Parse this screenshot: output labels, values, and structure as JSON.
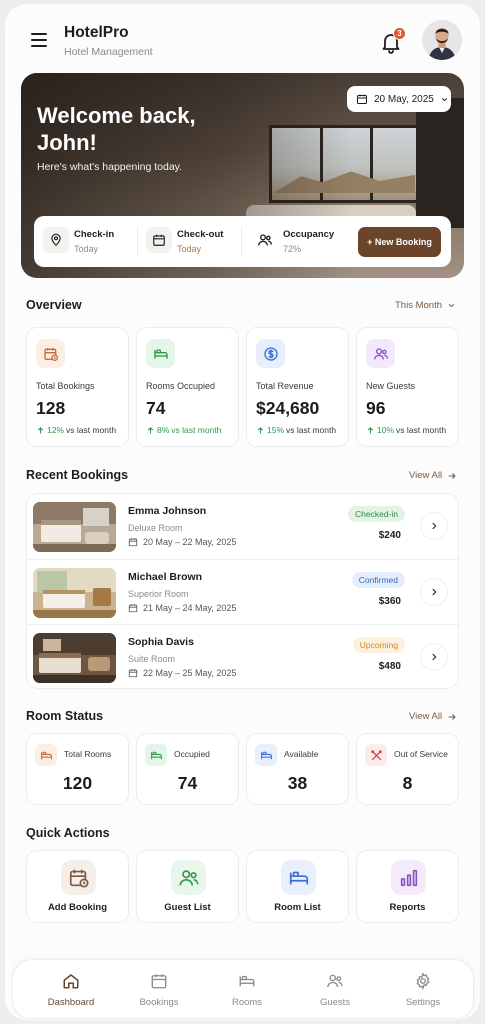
{
  "header": {
    "brand": "HotelPro",
    "subtitle": "Hotel Management",
    "notifications": "3",
    "icons": [
      "menu-icon",
      "bell-icon",
      "user-avatar"
    ]
  },
  "hero": {
    "title": "Welcome back, John!",
    "subtitle": "Here's what's happening today.",
    "date": "20 May, 2025",
    "stats": [
      {
        "label": "Check-in",
        "value": "Today",
        "icon": "location-pin-icon"
      },
      {
        "label": "Check-out",
        "value": "Today",
        "icon": "calendar-icon"
      },
      {
        "label": "Occupancy",
        "value": "72%",
        "icon": "users-icon"
      }
    ],
    "new_booking": "+ New Booking"
  },
  "overview": {
    "title": "Overview",
    "period": "This Month",
    "cards": [
      {
        "label": "Total Bookings",
        "value": "128",
        "change": "12%",
        "suffix": "vs last month",
        "icon": "calendar-clock-icon",
        "color": "#c8693a"
      },
      {
        "label": "Rooms Occupied",
        "value": "74",
        "change": "8%",
        "suffix": "vs last month",
        "icon": "bed-icon",
        "color": "#2e9a4a"
      },
      {
        "label": "Total Revenue",
        "value": "$24,680",
        "change": "15%",
        "suffix": "vs last month",
        "icon": "dollar-icon",
        "color": "#3a6fd8"
      },
      {
        "label": "New Guests",
        "value": "96",
        "change": "10%",
        "suffix": "vs last month",
        "icon": "users-icon",
        "color": "#8a4fc9"
      }
    ]
  },
  "recent": {
    "title": "Recent Bookings",
    "view_all": "View All",
    "items": [
      {
        "name": "Emma Johnson",
        "room": "Deluxe Room",
        "dates": "20 May – 22 May, 2025",
        "status": "Checked-in",
        "price": "$240",
        "status_bg": "#e3f4e6",
        "status_fg": "#2e8a45"
      },
      {
        "name": "Michael Brown",
        "room": "Superior Room",
        "dates": "21 May – 24 May, 2025",
        "status": "Confirmed",
        "price": "$360",
        "status_bg": "#e6eefb",
        "status_fg": "#3566c4"
      },
      {
        "name": "Sophia Davis",
        "room": "Suite Room",
        "dates": "22 May – 25 May, 2025",
        "status": "Upcoming",
        "price": "$480",
        "status_bg": "#fdf0df",
        "status_fg": "#d08a2a"
      }
    ]
  },
  "room_status": {
    "title": "Room Status",
    "view_all": "View All",
    "cards": [
      {
        "label": "Total Rooms",
        "value": "120",
        "icon": "bed-icon",
        "color": "#c8693a"
      },
      {
        "label": "Occupied",
        "value": "74",
        "icon": "bed-icon",
        "color": "#2e9a4a"
      },
      {
        "label": "Available",
        "value": "38",
        "icon": "bed-icon",
        "color": "#3a6fd8"
      },
      {
        "label": "Out of Service",
        "value": "8",
        "icon": "tools-icon",
        "color": "#d0453a"
      }
    ]
  },
  "quick_actions": {
    "title": "Quick Actions",
    "items": [
      {
        "label": "Add Booking",
        "icon": "calendar-clock-icon",
        "color": "#7a5a43"
      },
      {
        "label": "Guest List",
        "icon": "users-icon",
        "color": "#2e9a4a"
      },
      {
        "label": "Room List",
        "icon": "bed-icon",
        "color": "#3a6fd8"
      },
      {
        "label": "Reports",
        "icon": "bar-chart-icon",
        "color": "#8a4fc9"
      }
    ]
  },
  "tabs": [
    {
      "label": "Dashboard",
      "icon": "home-icon",
      "active": true
    },
    {
      "label": "Bookings",
      "icon": "calendar-icon",
      "active": false
    },
    {
      "label": "Rooms",
      "icon": "bed-icon",
      "active": false
    },
    {
      "label": "Guests",
      "icon": "users-icon",
      "active": false
    },
    {
      "label": "Settings",
      "icon": "gear-icon",
      "active": false
    }
  ]
}
